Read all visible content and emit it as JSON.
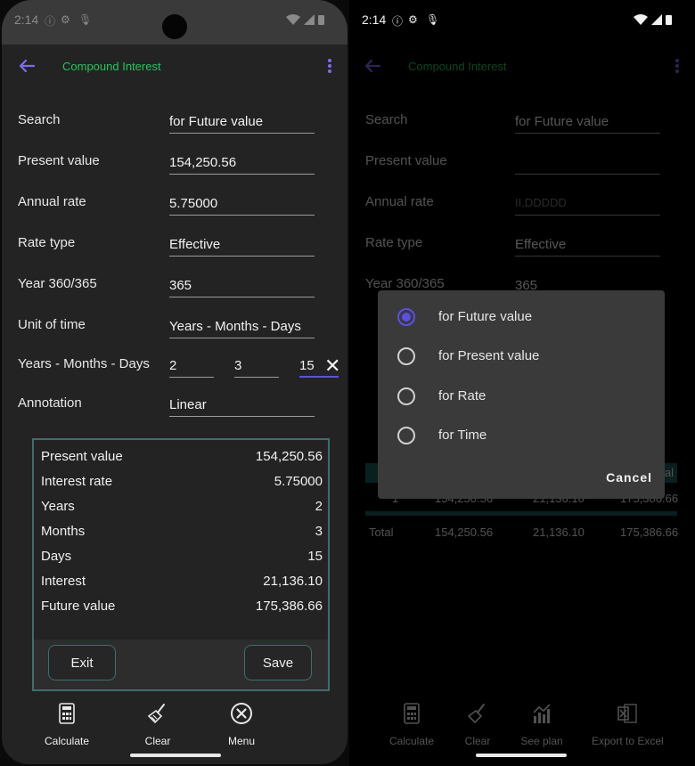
{
  "status": {
    "time": "2:14"
  },
  "app": {
    "title": "Compound Interest"
  },
  "form": {
    "search_label": "Search",
    "search_value": "for Future value",
    "pv_label": "Present value",
    "pv_value": "154,250.56",
    "rate_label": "Annual rate",
    "rate_value": "5.75000",
    "rate_type_label": "Rate type",
    "rate_type_value": "Effective",
    "year_label": "Year 360/365",
    "year_value": "365",
    "unit_label": "Unit of time",
    "unit_value": "Years - Months - Days",
    "ymd_label": "Years - Months - Days",
    "years": "2",
    "months": "3",
    "days": "15",
    "annotation_label": "Annotation",
    "annotation_value": "Linear"
  },
  "results": {
    "rows": [
      {
        "k": "Present value",
        "v": "154,250.56"
      },
      {
        "k": "Interest rate",
        "v": "5.75000"
      },
      {
        "k": "Years",
        "v": "2"
      },
      {
        "k": "Months",
        "v": "3"
      },
      {
        "k": "Days",
        "v": "15"
      },
      {
        "k": "Interest",
        "v": "21,136.10"
      },
      {
        "k": "Future value",
        "v": "175,386.66"
      }
    ],
    "exit_label": "Exit",
    "save_label": "Save"
  },
  "nav_left": {
    "calculate": "Calculate",
    "clear": "Clear",
    "menu": "Menu"
  },
  "right": {
    "rate_placeholder": "II.DDDDD",
    "table_header_partial": "tal",
    "row1": [
      "1",
      "154,250.56",
      "21,136.10",
      "175,386.66"
    ],
    "total": [
      "Total",
      "154,250.56",
      "21,136.10",
      "175,386.66"
    ]
  },
  "dialog": {
    "options": [
      "for Future value",
      "for Present value",
      "for Rate",
      "for Time"
    ],
    "selected": "for Future value",
    "cancel": "Cancel"
  },
  "nav_right": {
    "calculate": "Calculate",
    "clear": "Clear",
    "see_plan": "See plan",
    "export": "Export to Excel"
  },
  "colors": {
    "accent": "#5b4fe8",
    "title_green": "#22c55e",
    "card_border": "#3f6e6e",
    "teal": "#1d5a5a"
  }
}
